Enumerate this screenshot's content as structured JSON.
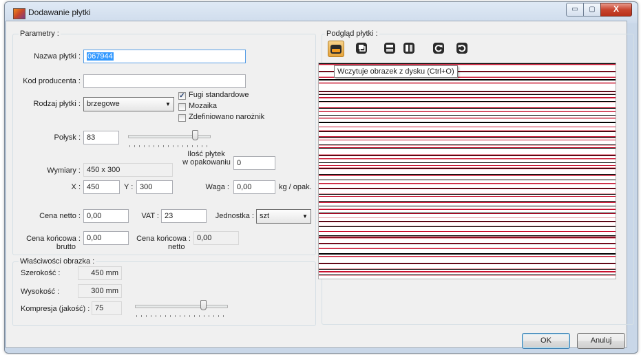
{
  "window": {
    "title": "Dodawanie płytki",
    "minimize_glyph": "▭",
    "maximize_glyph": "▢",
    "close_glyph": "X"
  },
  "params": {
    "group_label": "Parametry :",
    "name_label": "Nazwa płytki :",
    "name_value": "067944",
    "producer_code_label": "Kod producenta :",
    "producer_code_value": "",
    "type_label": "Rodzaj płytki :",
    "type_value": "brzegowe",
    "chk_grout_label": "Fugi standardowe",
    "chk_grout_checked": true,
    "chk_mosaic_label": "Mozaika",
    "chk_mosaic_checked": false,
    "chk_corner_label": "Zdefiniowano narożnik",
    "chk_corner_checked": false,
    "gloss_label": "Połysk :",
    "gloss_value": "83",
    "gloss_slider_level": 0.83,
    "per_pack_label_1": "Ilość płytek",
    "per_pack_label_2": "w opakowaniu",
    "per_pack_value": "0",
    "dims_label": "Wymiary :",
    "dims_value": "450 x 300",
    "x_label": "X :",
    "x_value": "450",
    "y_label": "Y :",
    "y_value": "300",
    "weight_label": "Waga :",
    "weight_value": "0,00",
    "weight_unit": "kg / opak.",
    "net_price_label": "Cena netto :",
    "net_price_value": "0,00",
    "vat_label": "VAT :",
    "vat_value": "23",
    "unit_label": "Jednostka :",
    "unit_value": "szt",
    "final_gross_label_1": "Cena końcowa :",
    "final_gross_label_2": "brutto",
    "final_gross_value": "0,00",
    "final_net_label_1": "Cena końcowa :",
    "final_net_label_2": "netto",
    "final_net_value": "0,00"
  },
  "image_props": {
    "group_label": "Właściwości obrazka :",
    "width_label": "Szerokość :",
    "width_value": "450 mm",
    "height_label": "Wysokość :",
    "height_value": "300 mm",
    "compression_label": "Kompresja (jakość) :",
    "compression_value": "75",
    "compression_slider_level": 0.75
  },
  "preview": {
    "group_label": "Podgląd płytki :",
    "tooltip": "Wczytuje obrazek z dysku (Ctrl+O)",
    "tools": [
      {
        "icon": "open-folder-icon"
      },
      {
        "icon": "copy-icon"
      },
      {
        "icon": "flip-horizontal-icon"
      },
      {
        "icon": "flip-vertical-icon"
      },
      {
        "icon": "rotate-right-icon"
      },
      {
        "icon": "rotate-left-icon"
      }
    ],
    "stripe_colors": [
      "#000000",
      "#c8102e",
      "#e8a0a8",
      "#ffffff"
    ]
  },
  "buttons": {
    "ok": "OK",
    "cancel": "Anuluj"
  }
}
